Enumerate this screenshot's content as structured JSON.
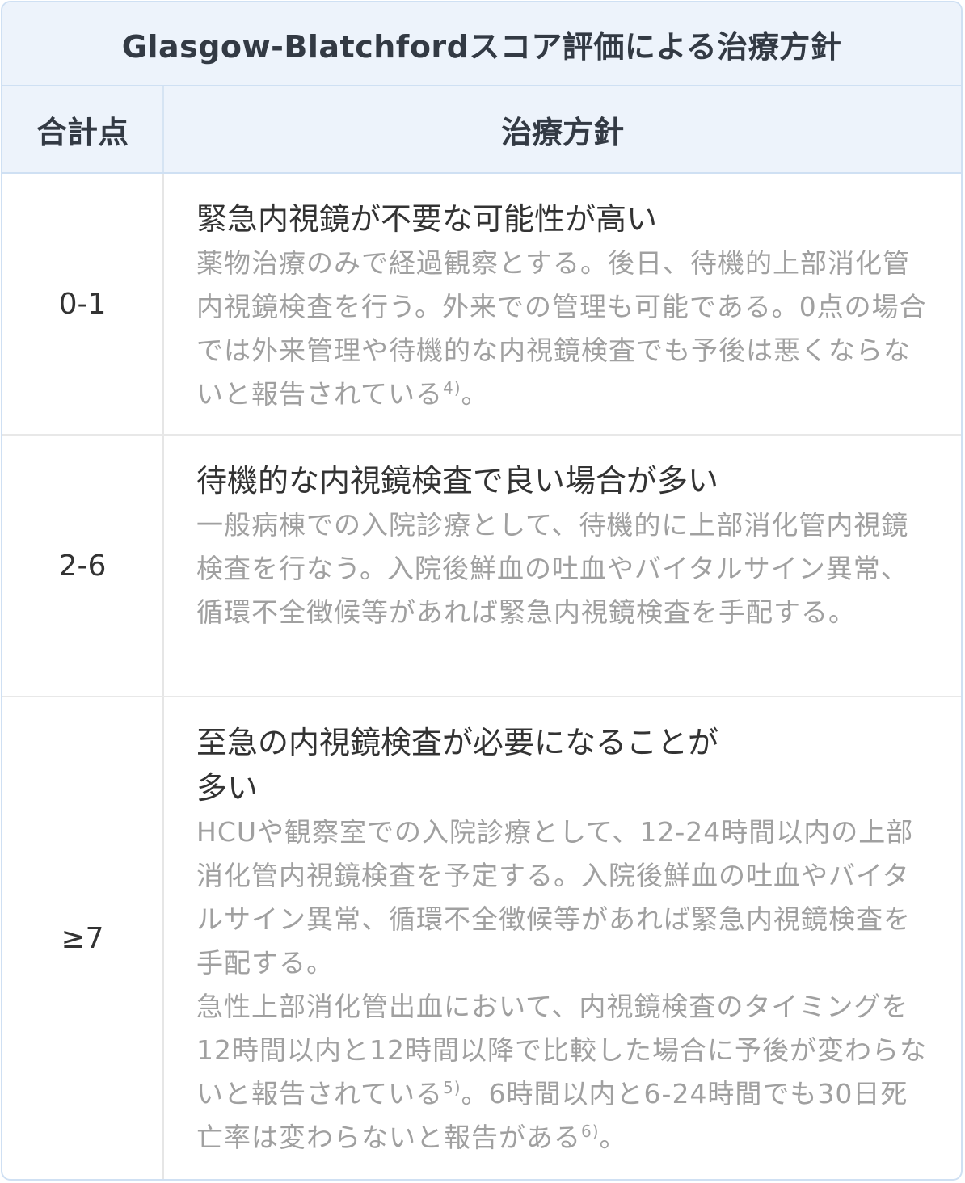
{
  "table": {
    "title": "Glasgow-Blatchfordスコア評価による治療方針",
    "headers": {
      "score": "合計点",
      "policy": "治療方針"
    },
    "rows": [
      {
        "score": "0-1",
        "heading": "緊急内視鏡が不要な可能性が高い",
        "desc": [
          {
            "text": "薬物治療のみで経過観察とする。後日、待機的上部消化管内視鏡検査を行う。外来での管理も可能である。0点の場合では外来管理や待機的な内視鏡検査でも予後は悪くならないと報告されている"
          },
          {
            "sup": "4)"
          },
          {
            "text": "。"
          }
        ]
      },
      {
        "score": "2-6",
        "heading": "待機的な内視鏡検査で良い場合が多い",
        "desc": [
          {
            "text": "一般病棟での入院診療として、待機的に上部消化管内視鏡検査を行なう。入院後鮮血の吐血やバイタルサイン異常、循環不全徴候等があれば緊急内視鏡検査を手配する。"
          }
        ]
      },
      {
        "score": "≥7",
        "heading": "至急の内視鏡検査が必要になることが\n多い",
        "desc": [
          {
            "text": "HCUや観察室での入院診療として、12-24時間以内の上部消化管内視鏡検査を予定する。入院後鮮血の吐血やバイタルサイン異常、循環不全徴候等があれば緊急内視鏡検査を手配する。"
          }
        ],
        "desc2": [
          {
            "text": "急性上部消化管出血において、内視鏡検査のタイミングを12時間以内と12時間以降で比較した場合に予後が変わらないと報告されている"
          },
          {
            "sup": "5)"
          },
          {
            "text": "。6時間以内と6-24時間でも30日死亡率は変わらないと報告がある"
          },
          {
            "sup": "6)"
          },
          {
            "text": "。"
          }
        ]
      }
    ]
  }
}
